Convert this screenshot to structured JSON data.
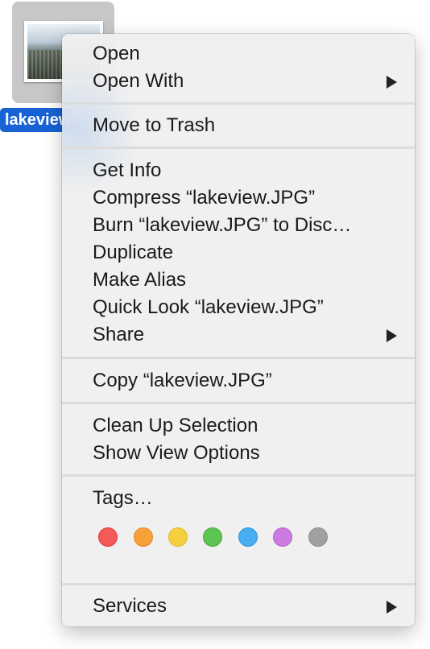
{
  "file": {
    "name": "lakeview"
  },
  "menu": {
    "open": "Open",
    "open_with": "Open With",
    "move_to_trash": "Move to Trash",
    "get_info": "Get Info",
    "compress": "Compress “lakeview.JPG”",
    "burn": "Burn “lakeview.JPG” to Disc…",
    "duplicate": "Duplicate",
    "make_alias": "Make Alias",
    "quick_look": "Quick Look “lakeview.JPG”",
    "share": "Share",
    "copy": "Copy “lakeview.JPG”",
    "clean_up": "Clean Up Selection",
    "show_view_options": "Show View Options",
    "tags": "Tags…",
    "services": "Services"
  },
  "tag_colors": [
    "#f55a5a",
    "#f7a03a",
    "#f6cf3e",
    "#5cc451",
    "#47aef2",
    "#cc7be0",
    "#a0a0a0"
  ],
  "tag_borders": [
    "#e03b3b",
    "#e08a22",
    "#e0b82a",
    "#46a83c",
    "#2f95d8",
    "#b461c9",
    "#8a8a8a"
  ]
}
